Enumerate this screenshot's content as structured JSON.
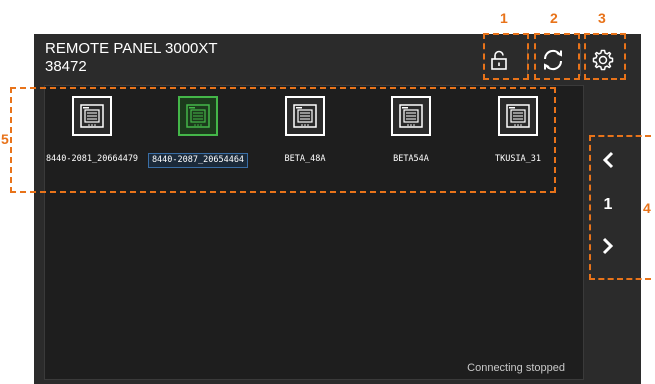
{
  "app": {
    "title_line1": "REMOTE PANEL 3000XT",
    "title_line2": "38472"
  },
  "toolbar": {
    "lock_icon": "unlock-icon",
    "refresh_icon": "refresh-icon",
    "settings_icon": "gear-icon"
  },
  "devices": [
    {
      "label": "8440-2081_20664479",
      "icon": "panel-device-icon",
      "selected": false
    },
    {
      "label": "8440-2087_20654464",
      "icon": "panel-device-icon",
      "selected": true
    },
    {
      "label": "BETA_48A",
      "icon": "panel-device-icon",
      "selected": false
    },
    {
      "label": "BETA54A",
      "icon": "panel-device-icon",
      "selected": false
    },
    {
      "label": "TKUSIA_31",
      "icon": "panel-device-icon",
      "selected": false
    }
  ],
  "pager": {
    "page": "1",
    "prev_icon": "chevron-left-icon",
    "next_icon": "chevron-right-icon"
  },
  "status": "Connecting stopped",
  "callouts": [
    "1",
    "2",
    "3",
    "4",
    "5"
  ],
  "colors": {
    "accent_orange": "#e8731a",
    "selected_green": "#44b649",
    "panel_bg": "#2b2b2b"
  }
}
